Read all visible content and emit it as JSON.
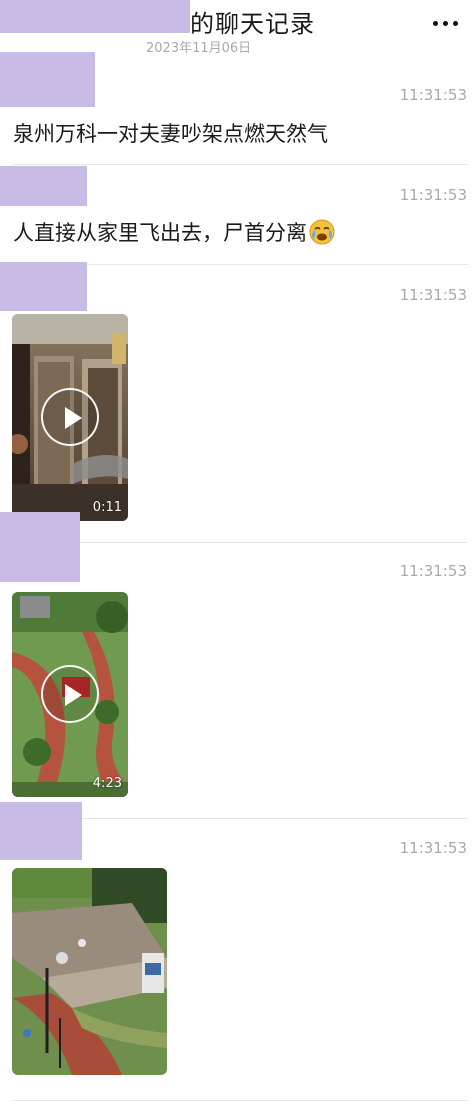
{
  "header": {
    "title": "的聊天记录",
    "date": "2023年11月06日",
    "more_icon": "more-horizontal-icon"
  },
  "messages": [
    {
      "time": "11:31:53",
      "text": "泉州万科一对夫妻吵架点燃天然气"
    },
    {
      "time": "11:31:53",
      "text": "人直接从家里飞出去，尸首分离",
      "emoji": "crying-face-emoji"
    },
    {
      "time": "11:31:53",
      "video_duration": "0:11"
    },
    {
      "time": "11:31:53",
      "video_duration": "4:23"
    },
    {
      "time": "11:31:53"
    }
  ],
  "colors": {
    "redaction": "#c8bce6",
    "time_text": "#a9a9a9",
    "divider": "#e6e6e6"
  }
}
